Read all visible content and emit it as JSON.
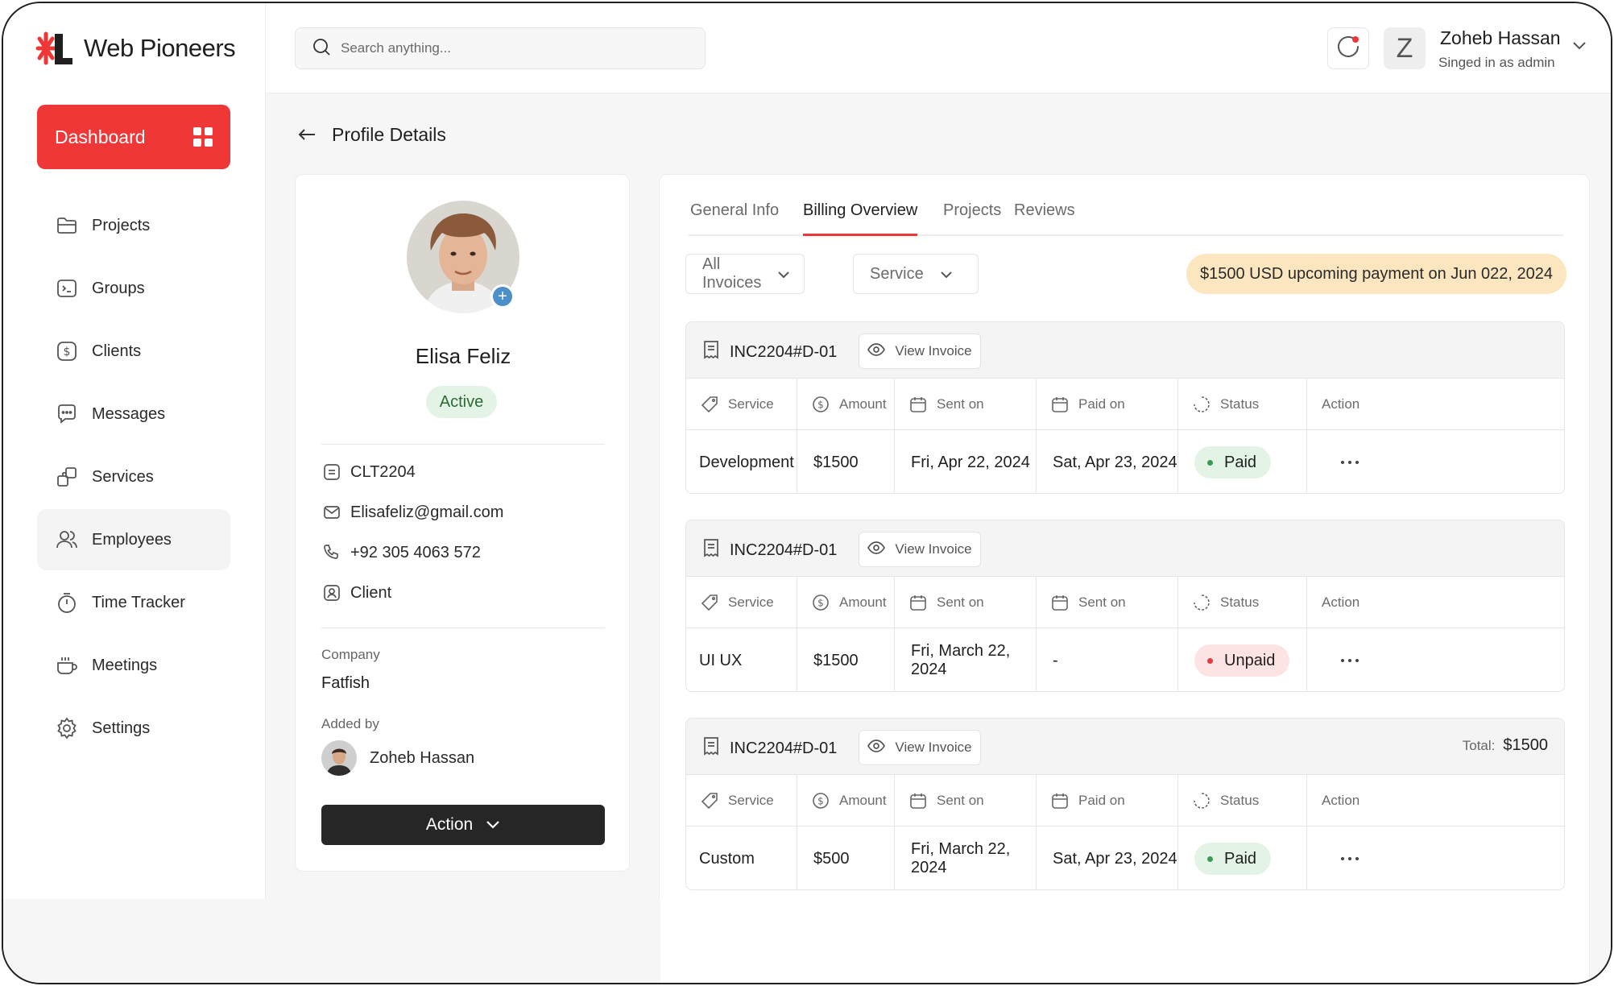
{
  "brand": {
    "name": "Web Pioneers",
    "accent": "#f03737"
  },
  "sidebar": {
    "dashboard_label": "Dashboard",
    "items": [
      {
        "label": "Projects",
        "icon": "folder-icon"
      },
      {
        "label": "Groups",
        "icon": "terminal-icon"
      },
      {
        "label": "Clients",
        "icon": "dollar-icon"
      },
      {
        "label": "Messages",
        "icon": "chat-icon"
      },
      {
        "label": "Services",
        "icon": "services-icon"
      },
      {
        "label": "Employees",
        "icon": "users-icon",
        "active": true
      },
      {
        "label": "Time Tracker",
        "icon": "stopwatch-icon"
      },
      {
        "label": "Meetings",
        "icon": "coffee-icon"
      },
      {
        "label": "Settings",
        "icon": "gear-icon"
      }
    ]
  },
  "header": {
    "search_placeholder": "Search anything...",
    "avatar_letter": "Z",
    "user_name": "Zoheb Hassan",
    "user_role": "Singed in as admin"
  },
  "page": {
    "title": "Profile Details"
  },
  "profile": {
    "name": "Elisa Feliz",
    "status": "Active",
    "id": "CLT2204",
    "email": "Elisafeliz@gmail.com",
    "phone": "+92 305 4063 572",
    "type": "Client",
    "company_label": "Company",
    "company": "Fatfish",
    "added_by_label": "Added by",
    "added_by": "Zoheb Hassan",
    "action_label": "Action"
  },
  "tabs": [
    "General Info",
    "Billing Overview",
    "Projects",
    "Reviews"
  ],
  "active_tab": "Billing Overview",
  "filters": {
    "invoices": "All Invoices",
    "service": "Service"
  },
  "upcoming_payment": "$1500 USD upcoming payment on Jun 022, 2024",
  "view_invoice_label": "View Invoice",
  "invoices": [
    {
      "id": "INC2204#D-01",
      "headers": [
        "Service",
        "Amount",
        "Sent on",
        "Paid on",
        "Status",
        "Action"
      ],
      "row": {
        "service": "Development",
        "amount": "$1500",
        "sent_on": "Fri, Apr 22, 2024",
        "paid_on": "Sat, Apr 23, 2024",
        "status": "Paid"
      }
    },
    {
      "id": "INC2204#D-01",
      "headers": [
        "Service",
        "Amount",
        "Sent on",
        "Sent on",
        "Status",
        "Action"
      ],
      "row": {
        "service": "UI UX",
        "amount": "$1500",
        "sent_on": "Fri, March 22, 2024",
        "paid_on": "-",
        "status": "Unpaid"
      }
    },
    {
      "id": "INC2204#D-01",
      "total_label": "Total:",
      "total": "$1500",
      "headers": [
        "Service",
        "Amount",
        "Sent on",
        "Paid on",
        "Status",
        "Action"
      ],
      "row": {
        "service": "Custom",
        "amount": "$500",
        "sent_on": "Fri, March 22, 2024",
        "paid_on": "Sat, Apr 23, 2024",
        "status": "Paid"
      }
    }
  ]
}
